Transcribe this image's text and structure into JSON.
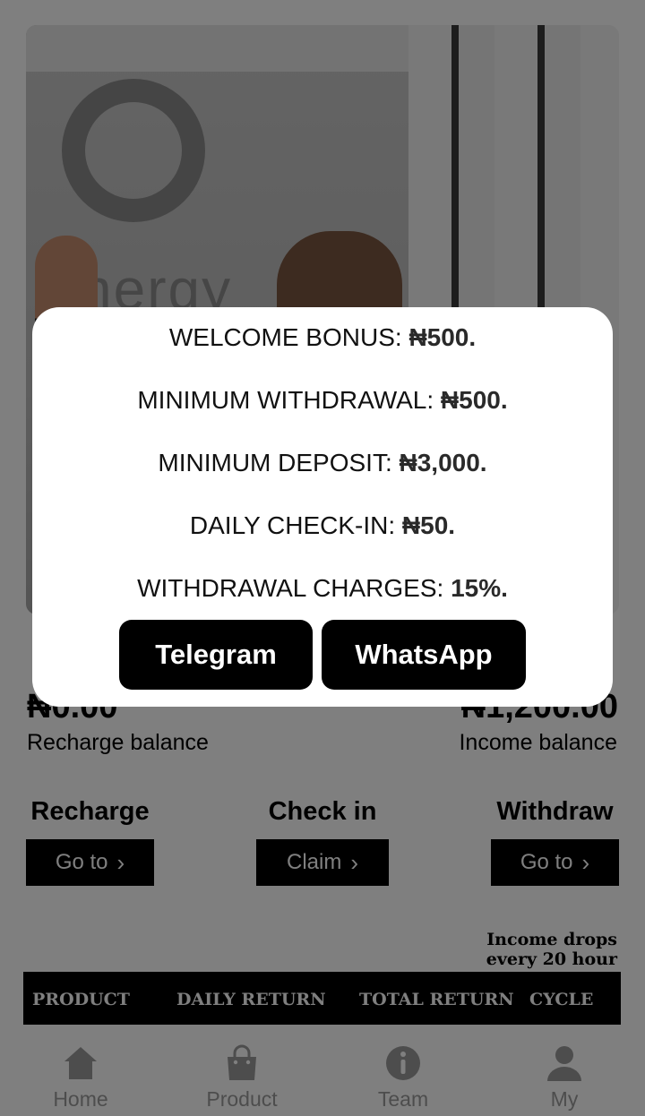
{
  "balances": {
    "recharge_amount": "₦0.00",
    "recharge_label": "Recharge balance",
    "income_amount": "₦1,200.00",
    "income_label": "Income balance"
  },
  "actions": [
    {
      "title": "Recharge",
      "button": "Go to"
    },
    {
      "title": "Check in",
      "button": "Claim"
    },
    {
      "title": "Withdraw",
      "button": "Go to"
    }
  ],
  "income_note": "Income drops every 20 hour",
  "table": {
    "headers": [
      "PRODUCT",
      "DAILY RETURN",
      "TOTAL RETURN",
      "CYCLE"
    ]
  },
  "nav": [
    {
      "label": "Home",
      "icon": "home-icon"
    },
    {
      "label": "Product",
      "icon": "shopping-bag-icon"
    },
    {
      "label": "Team",
      "icon": "info-icon"
    },
    {
      "label": "My",
      "icon": "user-icon"
    }
  ],
  "modal": {
    "lines": [
      {
        "label": "WELCOME BONUS: ",
        "value": "₦500."
      },
      {
        "label": "MINIMUM WITHDRAWAL: ",
        "value": "₦500."
      },
      {
        "label": "MINIMUM DEPOSIT: ",
        "value": "₦3,000."
      },
      {
        "label": "DAILY CHECK-IN: ",
        "value": "₦50."
      },
      {
        "label": "WITHDRAWAL CHARGES: ",
        "value": "15%."
      }
    ],
    "telegram_label": "Telegram",
    "whatsapp_label": "WhatsApp"
  },
  "colors": {
    "overlay": "rgba(0,0,0,0.5)",
    "button": "#000000",
    "nav_label": "#9a9a9a"
  }
}
